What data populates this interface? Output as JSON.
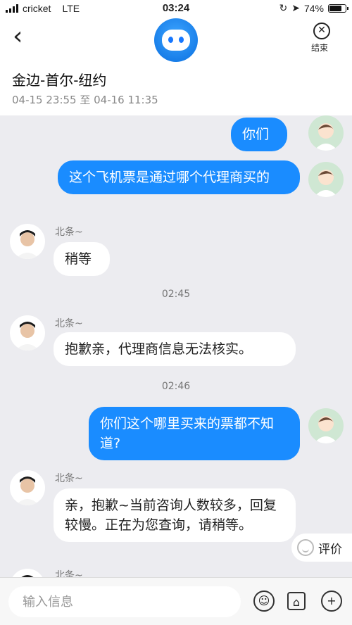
{
  "status_bar": {
    "carrier": "cricket",
    "network": "LTE",
    "time": "03:24",
    "battery_percent": "74%",
    "battery_level": 0.74
  },
  "header": {
    "end_label": "结束",
    "route": "金边-首尔-纽约",
    "date_range": "04-15 23:55 至 04-16 11:35"
  },
  "messages": [
    {
      "from": "me",
      "text": "你们"
    },
    {
      "from": "me",
      "text": "这个飞机票是通过哪个代理商买的"
    },
    {
      "from": "agent",
      "sender": "北条~",
      "text": "稍等"
    },
    {
      "timestamp": "02:45"
    },
    {
      "from": "agent",
      "sender": "北条~",
      "text": "抱歉亲，代理商信息无法核实。"
    },
    {
      "timestamp": "02:46"
    },
    {
      "from": "me",
      "text": "你们这个哪里买来的票都不知道?"
    },
    {
      "from": "agent",
      "sender": "北条~",
      "text": "亲，抱歉~当前咨询人数较多，回复较慢。正在为您查询，请稍等。"
    },
    {
      "from": "agent",
      "sender": "北条~",
      "text": ""
    }
  ],
  "rate_label": "评价",
  "input": {
    "placeholder": "输入信息"
  },
  "colors": {
    "accent": "#1a8cff",
    "background": "#ececf0"
  }
}
